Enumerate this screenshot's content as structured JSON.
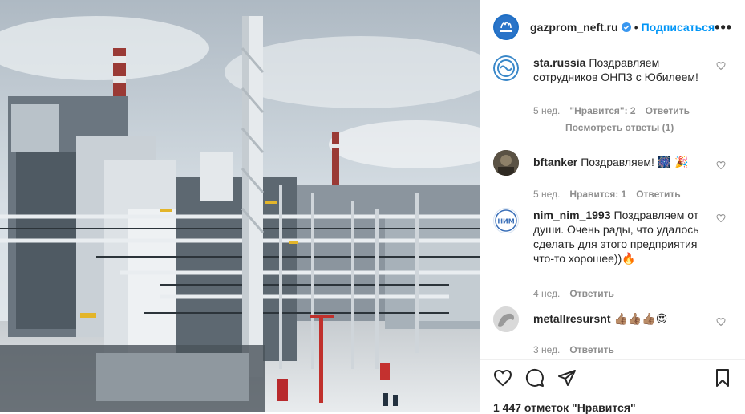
{
  "header": {
    "username": "gazprom_neft.ru",
    "separator": "•",
    "follow_label": "Подписаться",
    "more_label": "•••",
    "avatar_text": "ГАЗПРОМ",
    "verified_icon": "verified-badge-icon"
  },
  "comments": [
    {
      "user": "sta.russia",
      "text": "Поздравляем сотрудников ОНПЗ с Юбилеем!",
      "time": "5 нед.",
      "likes": "\"Нравится\": 2",
      "reply": "Ответить",
      "view_replies": "Посмотреть ответы (1)"
    },
    {
      "user": "bftanker",
      "text": "Поздравляем! 🎆 🎉",
      "time": "5 нед.",
      "likes": "Нравится: 1",
      "reply": "Ответить"
    },
    {
      "user": "nim_nim_1993",
      "text": "Поздравляем от души. Очень рады, что удалось сделать для этого предприятия что-то хорошее))🔥",
      "time": "4 нед.",
      "reply": "Ответить",
      "avatar_text": "НИМ"
    },
    {
      "user": "metallresursnt",
      "text": "👍🏽👍🏽👍🏽😍",
      "time": "3 нед.",
      "reply": "Ответить"
    }
  ],
  "footer": {
    "likes_count": "1 447 отметок \"Нравится\""
  },
  "colors": {
    "accent": "#0095f6",
    "verified": "#3897f0",
    "muted": "#8e8e8e",
    "text": "#262626"
  }
}
